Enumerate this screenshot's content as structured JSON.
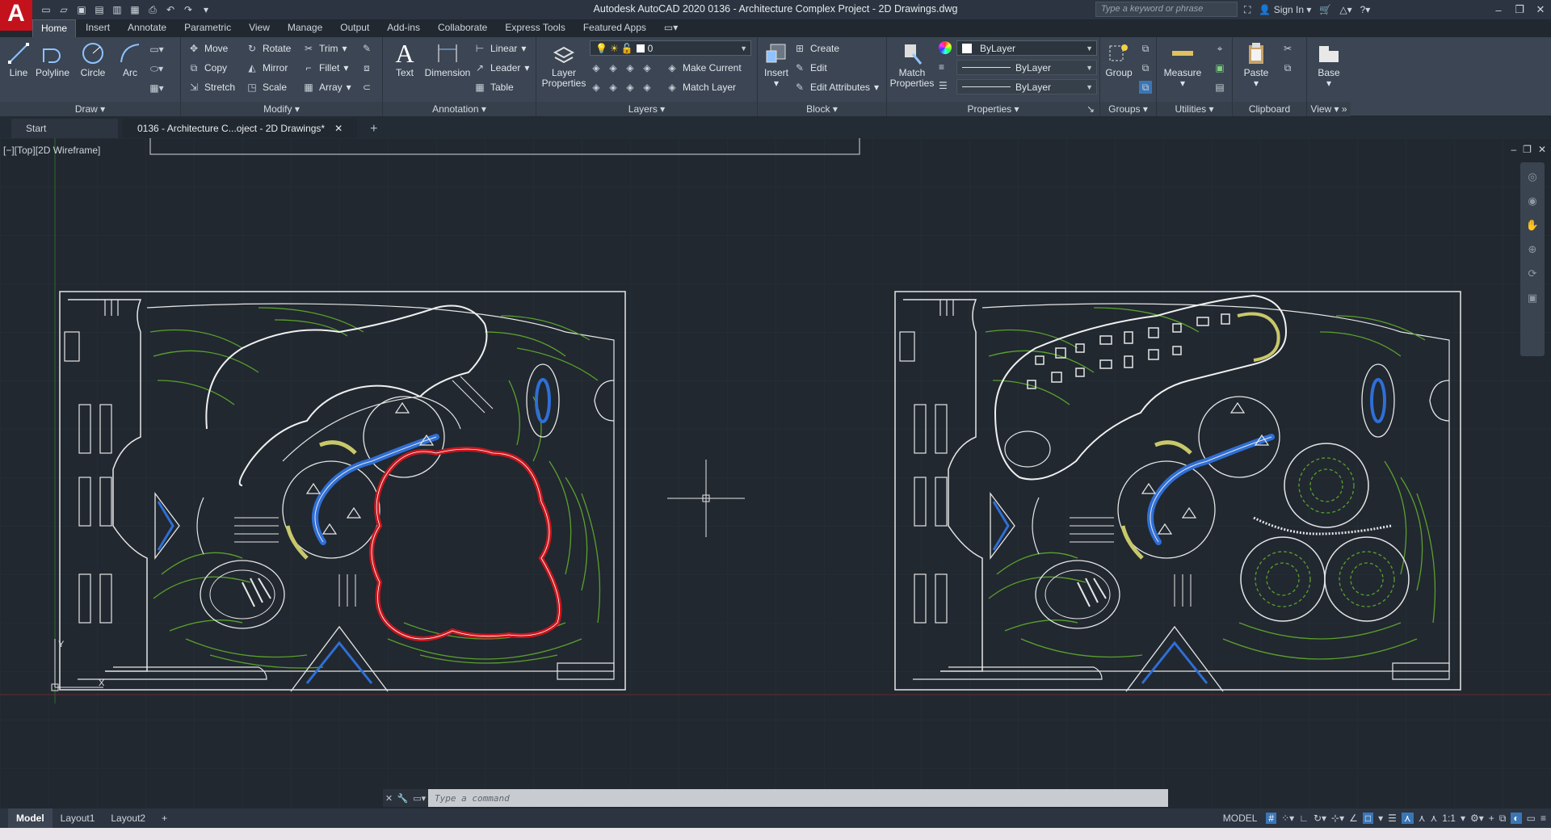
{
  "app": {
    "title": "Autodesk AutoCAD 2020    0136 - Architecture Complex Project - 2D Drawings.dwg",
    "logo_letter": "A",
    "search_placeholder": "Type a keyword or phrase",
    "sign_in": "Sign In"
  },
  "ribbon_tabs": [
    "Home",
    "Insert",
    "Annotate",
    "Parametric",
    "View",
    "Manage",
    "Output",
    "Add-ins",
    "Collaborate",
    "Express Tools",
    "Featured Apps"
  ],
  "ribbon_active_tab": "Home",
  "draw": {
    "title": "Draw",
    "line": "Line",
    "polyline": "Polyline",
    "circle": "Circle",
    "arc": "Arc"
  },
  "modify": {
    "title": "Modify",
    "move": "Move",
    "rotate": "Rotate",
    "trim": "Trim",
    "copy": "Copy",
    "mirror": "Mirror",
    "fillet": "Fillet",
    "stretch": "Stretch",
    "scale": "Scale",
    "array": "Array"
  },
  "annotation": {
    "title": "Annotation",
    "text": "Text",
    "dimension": "Dimension",
    "linear": "Linear",
    "leader": "Leader",
    "table": "Table"
  },
  "layers": {
    "title": "Layers",
    "layer_properties": "Layer Properties",
    "current_layer": "0",
    "make_current": "Make Current",
    "match_layer": "Match Layer"
  },
  "block": {
    "title": "Block",
    "insert": "Insert",
    "create": "Create",
    "edit": "Edit",
    "edit_attributes": "Edit Attributes"
  },
  "properties": {
    "title": "Properties",
    "match_properties": "Match Properties",
    "color": "ByLayer",
    "linetype": "ByLayer",
    "lineweight": "ByLayer"
  },
  "groups": {
    "title": "Groups",
    "group": "Group"
  },
  "utilities": {
    "title": "Utilities",
    "measure": "Measure"
  },
  "clipboard": {
    "title": "Clipboard",
    "paste": "Paste"
  },
  "view_panel": {
    "title": "View",
    "base": "Base"
  },
  "doc_tabs": {
    "start": "Start",
    "active": "0136 - Architecture C...oject - 2D Drawings*"
  },
  "viewport": {
    "label": "[−][Top][2D Wireframe]"
  },
  "command": {
    "placeholder": "Type a command"
  },
  "status": {
    "layouts": [
      "Model",
      "Layout1",
      "Layout2"
    ],
    "active_layout": "Model",
    "model": "MODEL",
    "scale": "1:1"
  },
  "colors": {
    "background": "#212830",
    "ribbon": "#3b4553",
    "landscape_green": "#5aa02c",
    "water_blue": "#2f6fd6",
    "highlight_red": "#c8161d",
    "linework": "#e6e6e6"
  }
}
